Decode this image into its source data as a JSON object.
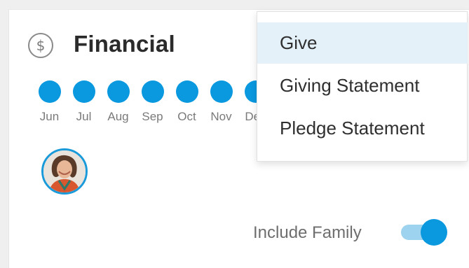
{
  "card": {
    "title": "Financial",
    "icon": "dollar-icon",
    "icon_glyph": "$"
  },
  "months": [
    "Jun",
    "Jul",
    "Aug",
    "Sep",
    "Oct",
    "Nov",
    "Dec"
  ],
  "toggle": {
    "label": "Include Family",
    "on": true
  },
  "menu": {
    "items": [
      "Give",
      "Giving Statement",
      "Pledge Statement"
    ],
    "active_index": 0
  },
  "colors": {
    "accent": "#0a98df",
    "accent_light": "#9ed3ef",
    "menu_highlight": "#e4f1f9"
  }
}
